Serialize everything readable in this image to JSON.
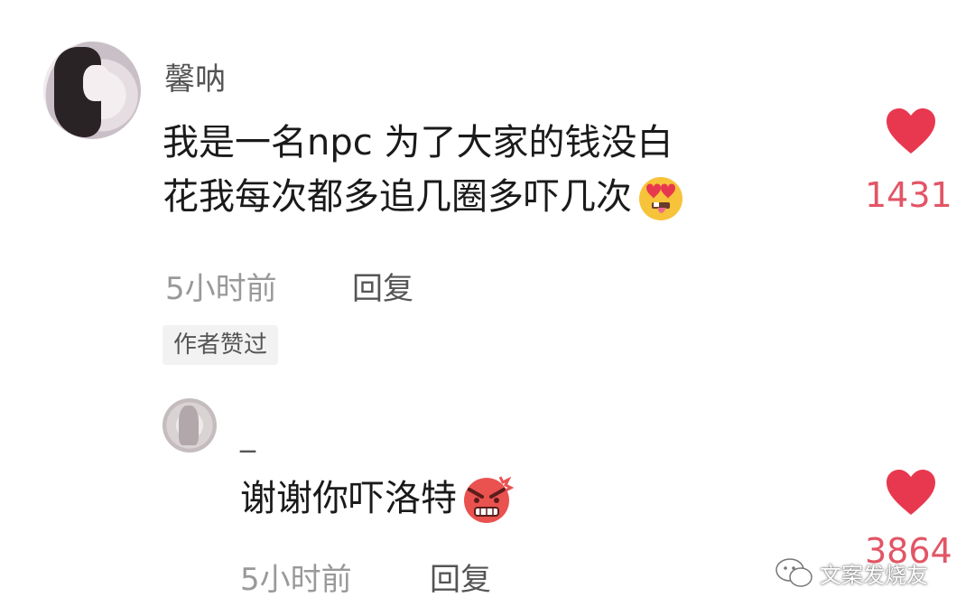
{
  "comments": [
    {
      "username": "馨呐",
      "text_line1": "我是一名npc 为了大家的钱没白",
      "text_line2": "花我每次都多追几圈多吓几次",
      "emoji": "heart-eyes-tongue-emoji",
      "time": "5小时前",
      "reply_label": "回复",
      "badge": "作者赞过",
      "like_count": "1431"
    },
    {
      "username": "_",
      "text": "谢谢你吓洛特",
      "emoji": "angry-face-emoji",
      "time": "5小时前",
      "reply_label": "回复",
      "like_count": "3864"
    }
  ],
  "watermark": {
    "text": "文案发烧友",
    "icon": "wechat-icon"
  },
  "colors": {
    "heart": "#e8384f",
    "count": "#e25565"
  }
}
